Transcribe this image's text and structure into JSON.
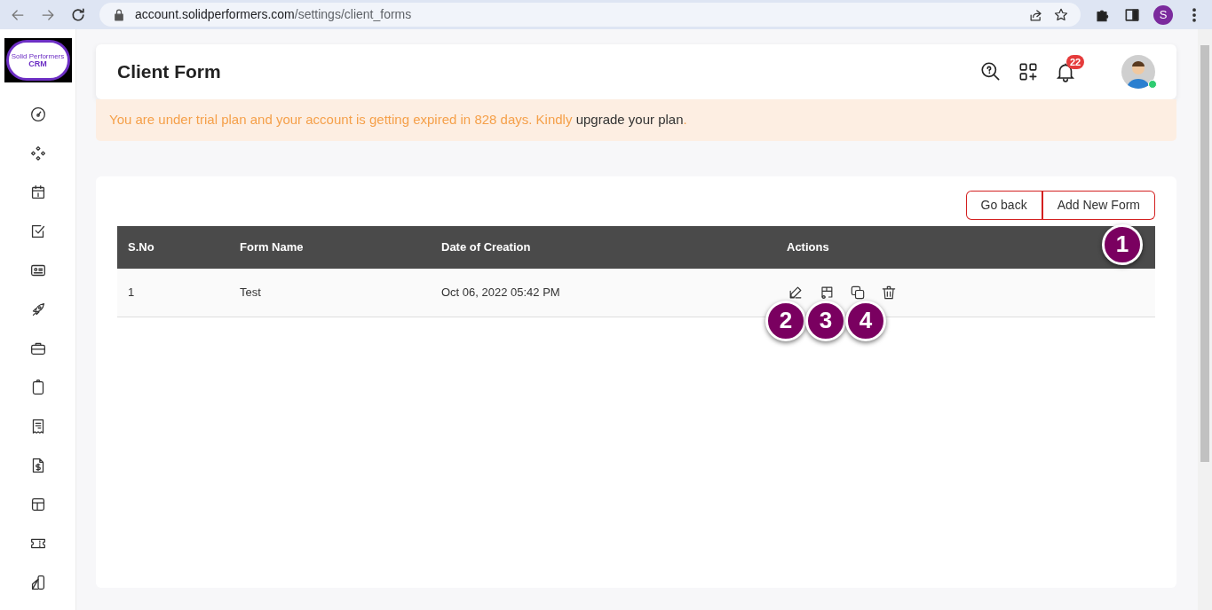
{
  "browser": {
    "url_host": "account.solidperformers.com",
    "url_path": "/settings/client_forms",
    "profile_initial": "S"
  },
  "logo": {
    "line_1": "Solid Performers",
    "line_2": "CRM"
  },
  "header": {
    "title": "Client Form",
    "notification_count": "22",
    "online": true
  },
  "banner": {
    "text": "You are under trial plan and your account is getting expired in 828 days. Kindly ",
    "link": "upgrade your plan",
    "end": "."
  },
  "toolbar": {
    "buttons": [
      "Go back",
      "Add New Form"
    ]
  },
  "table": {
    "columns": [
      "S.No",
      "Form Name",
      "Date of Creation",
      "Actions"
    ],
    "rows": [
      {
        "cells": [
          "1",
          "Test",
          "Oct 06, 2022 05:42 PM"
        ]
      }
    ]
  },
  "callouts": [
    "1",
    "2",
    "3",
    "4"
  ]
}
